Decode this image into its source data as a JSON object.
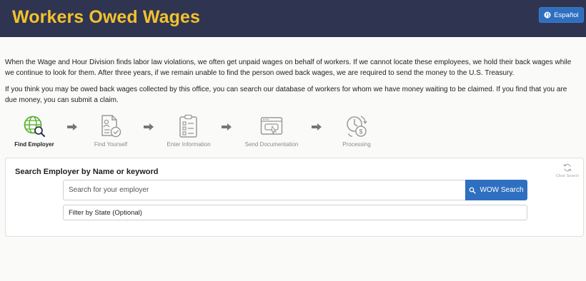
{
  "header": {
    "title": "Workers Owed Wages",
    "language_button": "Español"
  },
  "intro": {
    "paragraph1": "When the Wage and Hour Division finds labor law violations, we often get unpaid wages on behalf of workers. If we cannot locate these employees, we hold their back wages while we continue to look for them. After three years, if we remain unable to find the person owed back wages, we are required to send the money to the U.S. Treasury.",
    "paragraph2": "If you think you may be owed back wages collected by this office, you can search our database of workers for whom we have money waiting to be claimed. If you find that you are due money, you can submit a claim."
  },
  "steps": [
    {
      "label": "Find Employer",
      "icon": "globe-search-icon",
      "active": true
    },
    {
      "label": "Find Yourself",
      "icon": "document-check-icon",
      "active": false
    },
    {
      "label": "Enter Information",
      "icon": "clipboard-list-icon",
      "active": false
    },
    {
      "label": "Send Documentation",
      "icon": "browser-upload-icon",
      "active": false
    },
    {
      "label": "Processing",
      "icon": "clock-money-icon",
      "active": false
    }
  ],
  "search_card": {
    "title": "Search Employer by Name or keyword",
    "clear_label": "Clear Search",
    "search_placeholder": "Search for your employer",
    "search_value": "",
    "search_button": "WOW Search",
    "state_filter": "Filter by State (Optional)"
  },
  "colors": {
    "header_bg": "#2f3550",
    "title": "#f2c12e",
    "primary_button": "#2f6fc0",
    "active_step": "#5cb531",
    "inactive_step": "#a8a8a8"
  }
}
